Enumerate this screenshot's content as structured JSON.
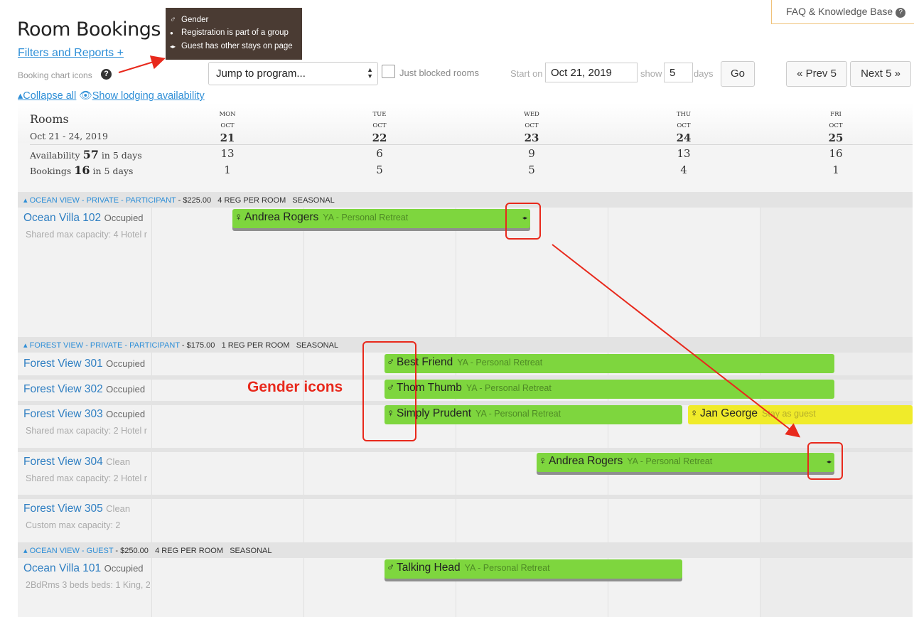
{
  "header": {
    "faq_label": "FAQ & Knowledge Base",
    "page_title": "Room Bookings",
    "filters_link": "Filters and Reports +",
    "icons_label": "Booking chart icons",
    "legend": [
      {
        "glyph": "♂",
        "text": "Gender"
      },
      {
        "glyph": "●",
        "text": "Registration is part of a group"
      },
      {
        "glyph": "◂▸",
        "text": "Guest has other stays on page"
      }
    ],
    "collapse_all": "Collapse all",
    "show_lodging": "Show lodging availability"
  },
  "toolbar": {
    "jump_select": "Jump to program...",
    "just_blocked": "Just blocked rooms",
    "start_on_label": "Start on",
    "start_date": "Oct 21, 2019",
    "show_label": "show",
    "days_value": "5",
    "days_label": "days",
    "go_label": "Go",
    "prev_label": "« Prev 5",
    "next_label": "Next 5 »"
  },
  "summary": {
    "rooms_title": "Rooms",
    "date_range": "Oct 21 - 24, 2019",
    "availability_label": "Availability",
    "availability_total": "57",
    "availability_suffix": "in 5 days",
    "bookings_label": "Bookings",
    "bookings_total": "16",
    "bookings_suffix": "in 5 days",
    "days": [
      {
        "dow": "MON",
        "mon": "OCT",
        "num": "21",
        "avail": "13",
        "book": "1"
      },
      {
        "dow": "TUE",
        "mon": "OCT",
        "num": "22",
        "avail": "6",
        "book": "5"
      },
      {
        "dow": "WED",
        "mon": "OCT",
        "num": "23",
        "avail": "9",
        "book": "5"
      },
      {
        "dow": "THU",
        "mon": "OCT",
        "num": "24",
        "avail": "13",
        "book": "4"
      },
      {
        "dow": "FRI",
        "mon": "OCT",
        "num": "25",
        "avail": "16",
        "book": "1"
      }
    ]
  },
  "groups": [
    {
      "name": "OCEAN VIEW - PRIVATE - PARTICIPANT",
      "price": "- $225.00",
      "per_room": "4 REG PER ROOM",
      "season": "SEASONAL"
    },
    {
      "name": "FOREST VIEW - PRIVATE - PARTICIPANT",
      "price": "- $175.00",
      "per_room": "1 REG PER ROOM",
      "season": "SEASONAL"
    },
    {
      "name": "OCEAN VIEW - GUEST",
      "price": "- $250.00",
      "per_room": "4 REG PER ROOM",
      "season": "SEASONAL"
    }
  ],
  "rooms": [
    {
      "name": "Ocean Villa 102",
      "status": "Occupied",
      "sub": "Shared max capacity: 4 Hotel r"
    },
    {
      "name": "Forest View 301",
      "status": "Occupied",
      "sub": ""
    },
    {
      "name": "Forest View 302",
      "status": "Occupied",
      "sub": ""
    },
    {
      "name": "Forest View 303",
      "status": "Occupied",
      "sub": "Shared max capacity: 2 Hotel r"
    },
    {
      "name": "Forest View 304",
      "status": "Clean",
      "sub": "Shared max capacity: 2 Hotel r"
    },
    {
      "name": "Forest View 305",
      "status": "Clean",
      "sub": "Custom max capacity: 2"
    },
    {
      "name": "Ocean Villa 101",
      "status": "Occupied",
      "sub": "2BdRms 3 beds beds: 1 King, 2"
    }
  ],
  "bookings": [
    {
      "gender": "♀",
      "guest": "Andrea Rogers",
      "program": "YA - Personal Retreat",
      "other": "◂▸"
    },
    {
      "gender": "♂",
      "guest": "Best Friend",
      "program": "YA - Personal Retreat"
    },
    {
      "gender": "♂",
      "guest": "Thom Thumb",
      "program": "YA - Personal Retreat"
    },
    {
      "gender": "♀",
      "guest": "Simply Prudent",
      "program": "YA - Personal Retreat"
    },
    {
      "gender": "♀",
      "guest": "Jan George",
      "program": "Stay as guest"
    },
    {
      "gender": "♀",
      "guest": "Andrea Rogers",
      "program": "YA - Personal Retreat",
      "other": "◂▸"
    },
    {
      "gender": "♂",
      "guest": "Talking Head",
      "program": "YA - Personal Retreat"
    }
  ],
  "annotation": {
    "gender_icons": "Gender icons",
    "color": "#e8291c"
  },
  "colors": {
    "booking_green": "#7ed63e",
    "booking_yellow": "#f0eb2a",
    "link_blue": "#2f8fd7",
    "legend_bg": "#4a3b33"
  }
}
